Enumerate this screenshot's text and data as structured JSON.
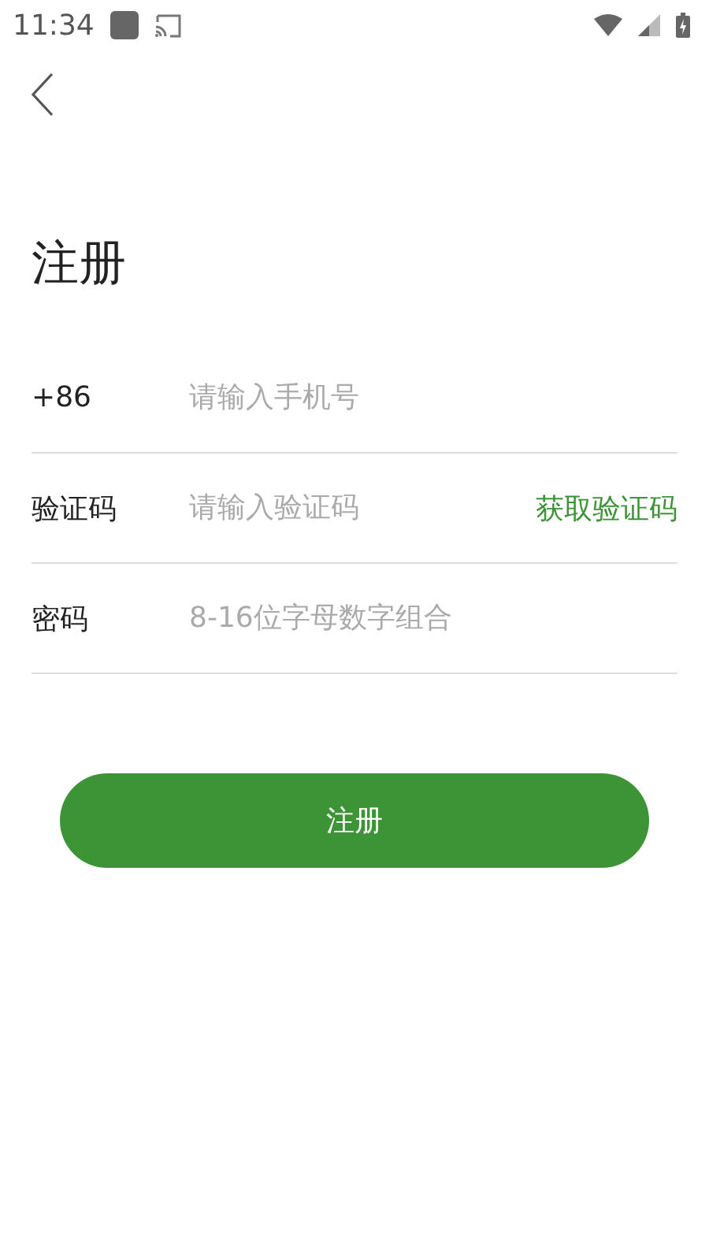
{
  "status_bar": {
    "time": "11:34"
  },
  "title": "注册",
  "fields": [
    {
      "label": "+86",
      "placeholder": "请输入手机号",
      "kind": "text"
    },
    {
      "label": "验证码",
      "placeholder": "请输入验证码",
      "kind": "code",
      "action": "获取验证码"
    },
    {
      "label": "密码",
      "placeholder": "8-16位字母数字组合",
      "kind": "password"
    }
  ],
  "submit": "注册"
}
